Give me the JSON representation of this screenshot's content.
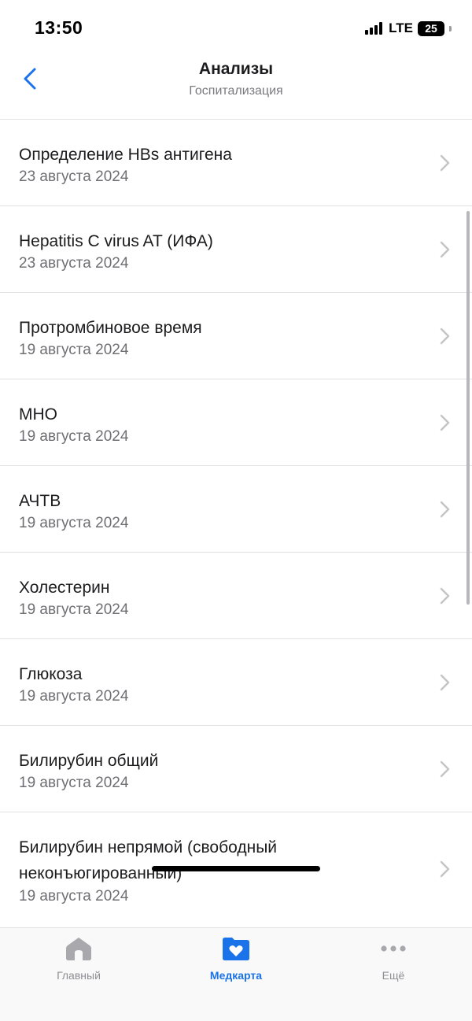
{
  "status_bar": {
    "time": "13:50",
    "network": "LTE",
    "battery": "25"
  },
  "header": {
    "title": "Анализы",
    "subtitle": "Госпитализация",
    "back_icon": "chevron-left-icon"
  },
  "items": [
    {
      "title": "Определение HBs антигена",
      "date": "23 августа 2024"
    },
    {
      "title": "Hepatitis C virus AT (ИФА)",
      "date": "23 августа 2024"
    },
    {
      "title": "Протромбиновое время",
      "date": "19 августа 2024"
    },
    {
      "title": "МНО",
      "date": "19 августа 2024"
    },
    {
      "title": "АЧТВ",
      "date": "19 августа 2024"
    },
    {
      "title": "Холестерин",
      "date": "19 августа 2024"
    },
    {
      "title": "Глюкоза",
      "date": "19 августа 2024"
    },
    {
      "title": "Билирубин общий",
      "date": "19 августа 2024"
    },
    {
      "title": "Билирубин непрямой (свободный неконъюгированный)",
      "date": "19 августа 2024"
    }
  ],
  "tabbar": {
    "home": {
      "label": "Главный",
      "icon": "home-icon"
    },
    "medcard": {
      "label": "Медкарта",
      "icon": "heart-folder-icon"
    },
    "more": {
      "label": "Ещё",
      "icon": "more-dots-icon"
    }
  },
  "colors": {
    "accent": "#1a73e8",
    "inactive": "#8e8e93",
    "divider": "#e2e2e6"
  }
}
